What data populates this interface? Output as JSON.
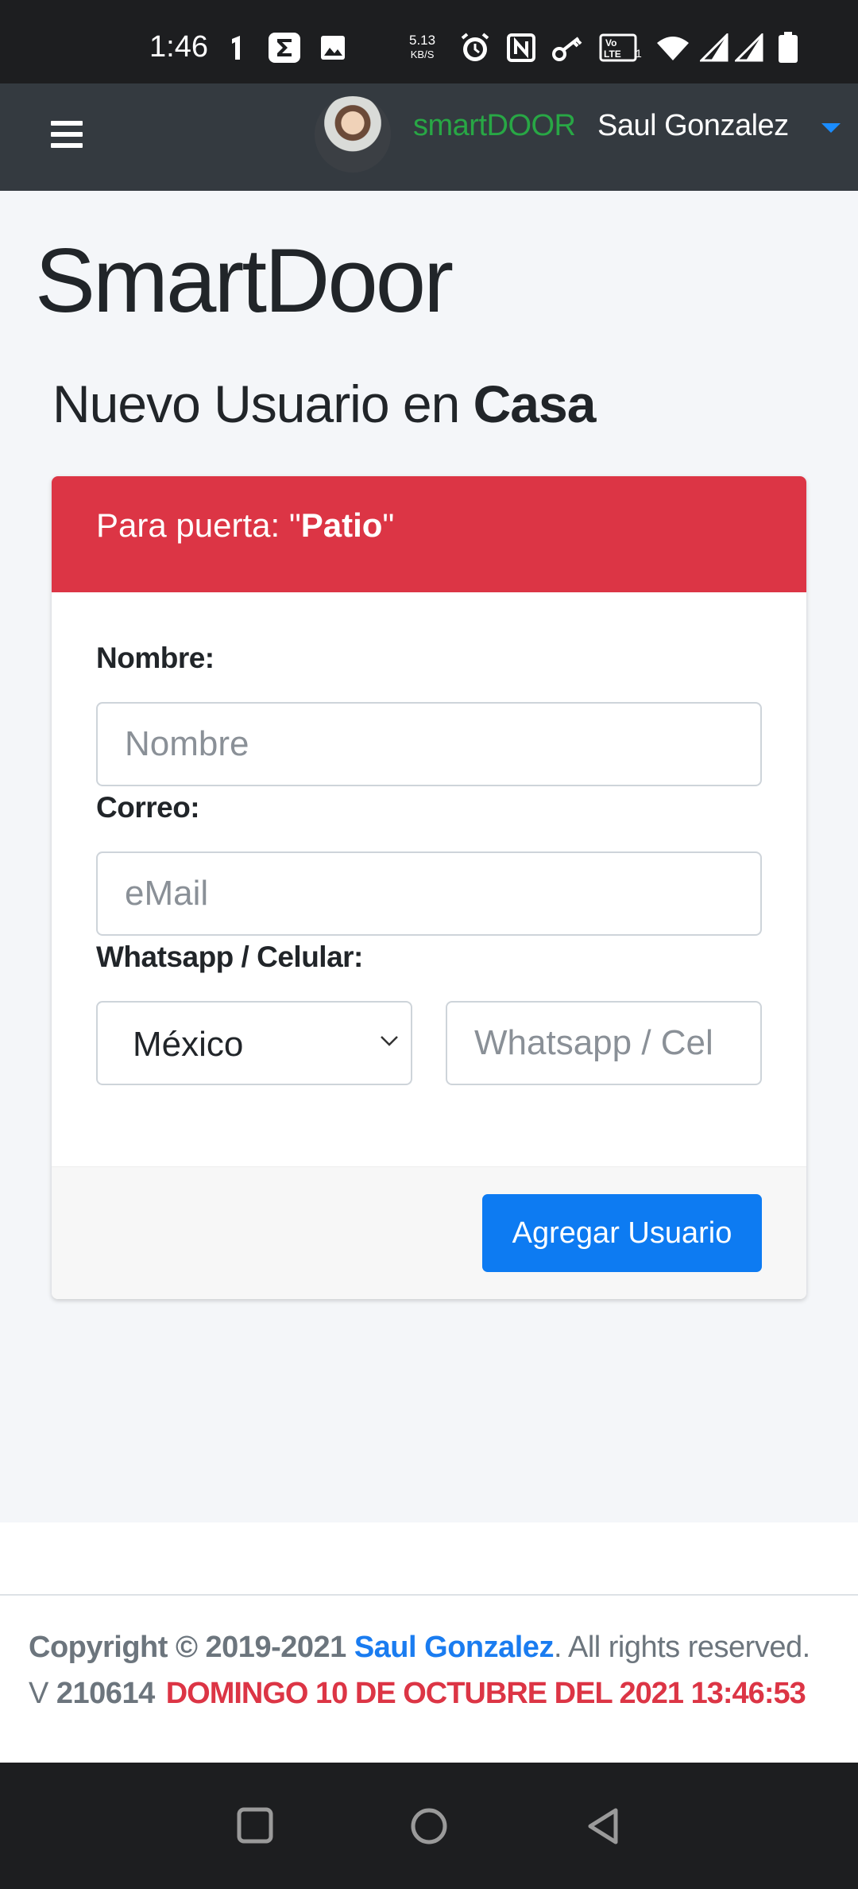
{
  "status_bar": {
    "time": "1:46",
    "net_speed_value": "5.13",
    "net_speed_unit": "KB/S",
    "icons": [
      "notification-1-icon",
      "sigma-app-icon",
      "gallery-icon",
      "alarm-icon",
      "nfc-icon",
      "key-icon",
      "volte-icon",
      "wifi-icon",
      "signal-icon",
      "signal-icon",
      "battery-icon"
    ]
  },
  "navbar": {
    "brand": "smartDOOR",
    "user_name": "Saul Gonzalez",
    "menu_icon": "hamburger-icon",
    "dropdown_icon": "caret-down-icon"
  },
  "page": {
    "app_title": "SmartDoor",
    "subtitle_prefix": "Nuevo Usuario en ",
    "subtitle_bold": "Casa"
  },
  "card": {
    "header_prefix": "Para puerta: \"",
    "header_bold": "Patio",
    "header_suffix": "\"",
    "name_label": "Nombre:",
    "name_placeholder": "Nombre",
    "email_label": "Correo:",
    "email_placeholder": "eMail",
    "phone_label": "Whatsapp / Celular:",
    "country_selected": "México",
    "phone_placeholder": "Whatsapp / Cel",
    "submit_label": "Agregar Usuario"
  },
  "footer": {
    "copyright_prefix": "Copyright © 2019-2021 ",
    "author": "Saul Gonzalez",
    "rights": ". All rights reserved.",
    "version_prefix": "V ",
    "version": "210614",
    "datetime": "DOMINGO 10 DE OCTUBRE DEL 2021 13:46:53"
  },
  "colors": {
    "navbar": "#343a40",
    "brand_green": "#28a745",
    "header_red": "#dc3545",
    "button_blue": "#0d7bf2",
    "link_blue": "#1a7cf0"
  }
}
